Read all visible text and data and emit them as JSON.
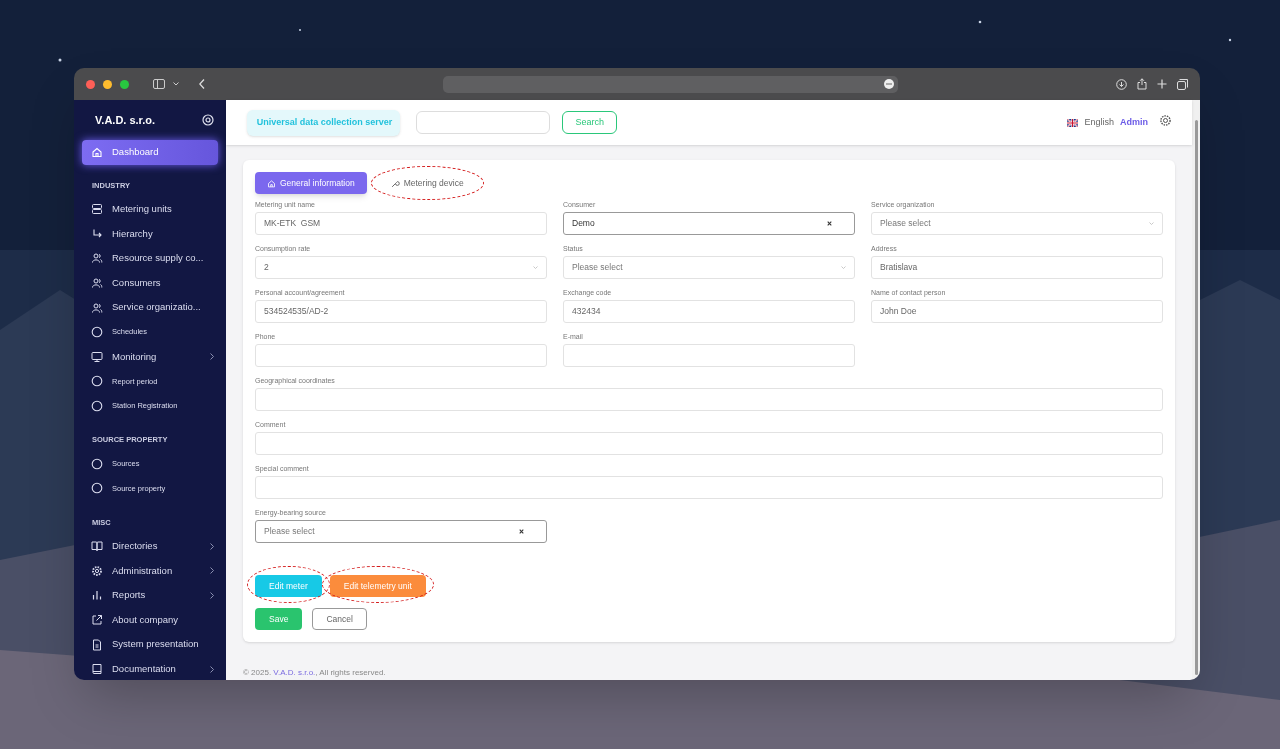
{
  "sidebar": {
    "brand": "V.A.D. s.r.o.",
    "sections": [
      {
        "items": [
          {
            "label": "Dashboard",
            "kind": "home",
            "selected": true,
            "expandable": false
          }
        ]
      },
      {
        "title": "INDUSTRY",
        "items": [
          {
            "label": "Metering units",
            "kind": "server",
            "selected": false,
            "expandable": false
          },
          {
            "label": "Hierarchy",
            "kind": "turn",
            "selected": false,
            "expandable": false
          },
          {
            "label": "Resource supply co...",
            "kind": "users",
            "selected": false,
            "expandable": false
          },
          {
            "label": "Consumers",
            "kind": "users",
            "selected": false,
            "expandable": false
          },
          {
            "label": "Service organizatio...",
            "kind": "users",
            "selected": false,
            "expandable": false
          },
          {
            "label": "Schedules",
            "kind": "circle",
            "selected": false,
            "expandable": false
          },
          {
            "label": "Monitoring",
            "kind": "monitor",
            "selected": false,
            "expandable": true
          },
          {
            "label": "Report period",
            "kind": "circle",
            "selected": false,
            "expandable": false
          },
          {
            "label": "Station Registration",
            "kind": "circle",
            "selected": false,
            "expandable": false
          }
        ]
      },
      {
        "title": "SOURCE PROPERTY",
        "items": [
          {
            "label": "Sources",
            "kind": "circle",
            "selected": false,
            "expandable": false
          },
          {
            "label": "Source property",
            "kind": "circle",
            "selected": false,
            "expandable": false
          }
        ]
      },
      {
        "title": "MISC",
        "items": [
          {
            "label": "Directories",
            "kind": "book",
            "selected": false,
            "expandable": true
          },
          {
            "label": "Administration",
            "kind": "gear",
            "selected": false,
            "expandable": true
          },
          {
            "label": "Reports",
            "kind": "bars",
            "selected": false,
            "expandable": true
          },
          {
            "label": "About company",
            "kind": "external",
            "selected": false,
            "expandable": false
          },
          {
            "label": "System presentation",
            "kind": "file",
            "selected": false,
            "expandable": false
          },
          {
            "label": "Documentation",
            "kind": "book2",
            "selected": false,
            "expandable": true
          }
        ]
      }
    ]
  },
  "header": {
    "app_badge": "Universal data collection server",
    "search_button": "Search",
    "language": "English",
    "user": "Admin"
  },
  "tabs": [
    {
      "label": "General information",
      "kind": "home",
      "selected": true,
      "circled": false
    },
    {
      "label": "Metering device",
      "kind": "wrench",
      "selected": false,
      "circled": true
    }
  ],
  "form_rows": [
    [
      {
        "label": "Metering unit name",
        "kind": "text",
        "value": "MK-ETK  GSM"
      },
      {
        "label": "Consumer",
        "kind": "clear-select",
        "value": "Demo"
      },
      {
        "label": "Service organization",
        "kind": "select",
        "placeholder": "Please select"
      }
    ],
    [
      {
        "label": "Consumption rate",
        "kind": "select",
        "value": "2"
      },
      {
        "label": "Status",
        "kind": "select",
        "placeholder": "Please select"
      },
      {
        "label": "Address",
        "kind": "text",
        "value": "Bratislava"
      }
    ],
    [
      {
        "label": "Personal account/agreement",
        "kind": "text",
        "value": "534524535/AD-2"
      },
      {
        "label": "Exchange code",
        "kind": "text",
        "value": "432434"
      },
      {
        "label": "Name of contact person",
        "kind": "text",
        "value": "John Doe"
      }
    ],
    [
      {
        "label": "Phone",
        "kind": "text"
      },
      {
        "label": "E-mail",
        "kind": "text"
      }
    ],
    [
      {
        "label": "Geographical coordinates",
        "kind": "wide-text"
      }
    ],
    [
      {
        "label": "Comment",
        "kind": "wide-text"
      }
    ],
    [
      {
        "label": "Special comment",
        "kind": "wide-text"
      }
    ],
    [
      {
        "label": "Energy-bearing source",
        "kind": "clear-select",
        "placeholder": "Please select"
      }
    ]
  ],
  "edit_buttons": [
    {
      "label": "Edit meter",
      "color": "#17c9e6",
      "circled": true
    },
    {
      "label": "Edit telemetry unit",
      "color": "#fb8c3c",
      "circled": true
    }
  ],
  "actions": {
    "save": "Save",
    "cancel": "Cancel"
  },
  "footer": {
    "prefix": "© 2025. ",
    "company": "V.A.D. s.r.o.",
    "suffix": ", All rights reserved."
  }
}
